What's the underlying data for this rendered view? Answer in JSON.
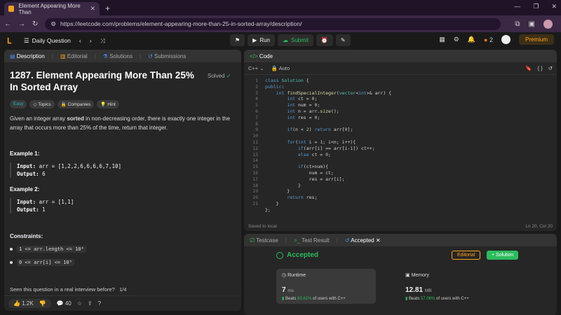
{
  "browser": {
    "tab_title": "Element Appearing More Than",
    "url": "https://leetcode.com/problems/element-appearing-more-than-25-in-sorted-array/description/"
  },
  "nav": {
    "daily": "Daily Question",
    "run": "Run",
    "submit": "Submit",
    "streak": "2",
    "premium": "Premium"
  },
  "left": {
    "tabs": [
      "Description",
      "Editorial",
      "Solutions",
      "Submissions"
    ],
    "title": "1287. Element Appearing More Than 25% In Sorted Array",
    "solved": "Solved",
    "tags": [
      "Easy",
      "Topics",
      "Companies",
      "Hint"
    ],
    "description_pre": "Given an integer array ",
    "description_bold": "sorted",
    "description_post": " in non-decreasing order, there is exactly one integer in the array that occurs more than 25% of the time, return that integer.",
    "example1_title": "Example 1:",
    "example1_input": "arr = [1,2,2,6,6,6,6,7,10]",
    "example1_output": "6",
    "example2_title": "Example 2:",
    "example2_input": "arr = [1,1]",
    "example2_output": "1",
    "constraints_title": "Constraints:",
    "constraint1": "1 <= arr.length <= 10⁴",
    "constraint2": "0 <= arr[i] <= 10⁵",
    "seen_question": "Seen this question in a real interview before?",
    "seen_page": "1/4",
    "likes": "1.2K",
    "comments": "40",
    "input_label": "Input:",
    "output_label": "Output:"
  },
  "code": {
    "title": "Code",
    "language": "C++",
    "mode": "Auto",
    "saved": "Saved to local",
    "cursor": "Ln 20, Col 20"
  },
  "result": {
    "tabs": [
      "Testcase",
      "Test Result",
      "Accepted"
    ],
    "status": "Accepted",
    "editorial": "Editorial",
    "solution": "+ Solution",
    "runtime_label": "Runtime",
    "runtime_value": "7",
    "runtime_unit": "ms",
    "runtime_beats": "83.61%",
    "memory_label": "Memory",
    "memory_value": "12.81",
    "memory_unit": "MB",
    "memory_beats": "57.06%",
    "beats_prefix": "Beats",
    "beats_suffix": "of users with C++"
  }
}
